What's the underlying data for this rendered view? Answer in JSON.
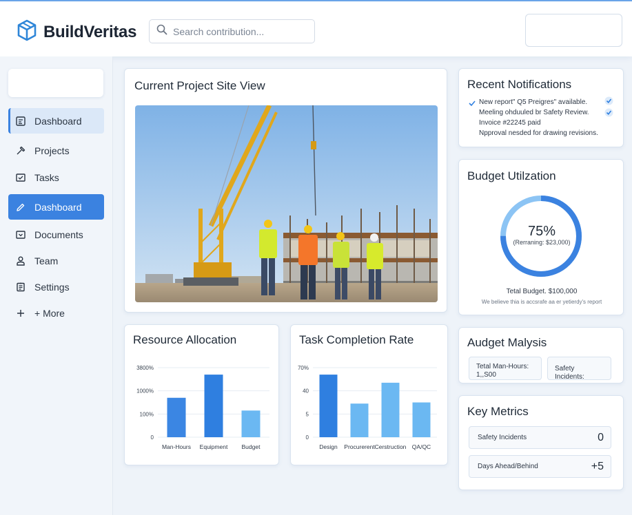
{
  "app": {
    "name": "BuildVeritas"
  },
  "search": {
    "placeholder": "Search contribution..."
  },
  "sidebar": {
    "items": [
      {
        "label": "Dashboard",
        "icon": "dashboard-icon"
      },
      {
        "label": "Projects",
        "icon": "hammer-icon"
      },
      {
        "label": "Tasks",
        "icon": "tasks-icon"
      },
      {
        "label": "Dashboard",
        "icon": "pencil-icon"
      },
      {
        "label": "Documents",
        "icon": "documents-icon"
      },
      {
        "label": "Team",
        "icon": "person-icon"
      },
      {
        "label": "Settings",
        "icon": "settings-icon"
      },
      {
        "label": "+ More",
        "icon": "plus-icon"
      }
    ]
  },
  "site_view": {
    "title": "Current Project Site View"
  },
  "notifications": {
    "title": "Recent Notifications",
    "items": [
      {
        "text": "New report\" Q5 Preigres\" available."
      },
      {
        "text": "Meeling ohduuled br Safety Review."
      },
      {
        "text": "Invoice #22245 paid"
      },
      {
        "text": "Npproval nesded for drawing revisions."
      }
    ]
  },
  "budget": {
    "title": "Budget Utilzation",
    "percent_label": "75%",
    "remaining_label": "(Rerraning: $23,000)",
    "total_label": "Tetal Budget. $100,000",
    "footnote": "We believe thia is accsrafe aa er yetierdy's report",
    "fraction": 0.75,
    "color": "#3b82e0",
    "track_color": "#8cc4f4"
  },
  "resource_allocation": {
    "title": "Resource Allocation",
    "chart_data": {
      "type": "bar",
      "categories": [
        "Man-Hours",
        "Equipment",
        "Budget"
      ],
      "values": [
        1.7,
        2.7,
        1.15
      ],
      "y_tick_labels": [
        "0",
        "100%",
        "1000%",
        "3800%"
      ],
      "colors": [
        "#3b86e3",
        "#2f7fe0",
        "#6bb8f2"
      ]
    }
  },
  "task_completion": {
    "title": "Task Completion Rate",
    "chart_data": {
      "type": "bar",
      "categories": [
        "Design",
        "Procurerent",
        "Cerstruction",
        "QA/QC"
      ],
      "values": [
        2.7,
        1.45,
        2.35,
        1.5
      ],
      "y_tick_labels": [
        "0",
        "5",
        "40",
        "70%"
      ],
      "colors": [
        "#2f7fe0",
        "#6bb8f2",
        "#6bb8f2",
        "#6bb8f2"
      ]
    }
  },
  "analysis": {
    "title": "Audget Malysis",
    "man_hours_label": "Tetal Man-Hours:",
    "man_hours_value": "1,,S00",
    "safety_label": "Safety Incidents:"
  },
  "metrics": {
    "title": "Key Metrics",
    "rows": [
      {
        "label": "Safety Incidents",
        "value": "0"
      },
      {
        "label": "Days Ahead/Behind",
        "value": "+5"
      }
    ]
  }
}
